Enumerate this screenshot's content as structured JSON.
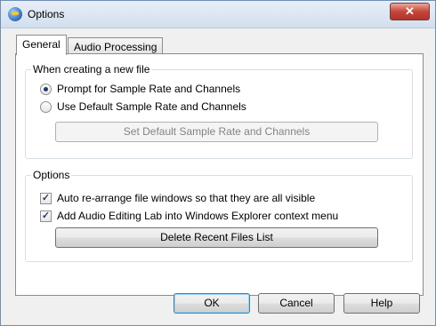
{
  "window": {
    "title": "Options",
    "close_glyph": "✕"
  },
  "tabs": [
    {
      "label": "General",
      "active": true
    },
    {
      "label": "Audio Processing",
      "active": false
    }
  ],
  "group_new_file": {
    "label": "When creating a new file",
    "options": [
      {
        "label": "Prompt for Sample Rate and Channels",
        "selected": true
      },
      {
        "label": "Use Default Sample Rate and Channels",
        "selected": false
      }
    ],
    "set_default_button": "Set Default Sample Rate and Channels"
  },
  "group_options": {
    "label": "Options",
    "checks": [
      {
        "label": "Auto re-arrange file windows so that they are all visible",
        "checked": true
      },
      {
        "label": "Add Audio Editing Lab into Windows Explorer context menu",
        "checked": true
      }
    ],
    "delete_recent_button": "Delete Recent Files List"
  },
  "footer": {
    "ok": "OK",
    "cancel": "Cancel",
    "help": "Help"
  },
  "glyphs": {
    "checkmark": "✓"
  }
}
